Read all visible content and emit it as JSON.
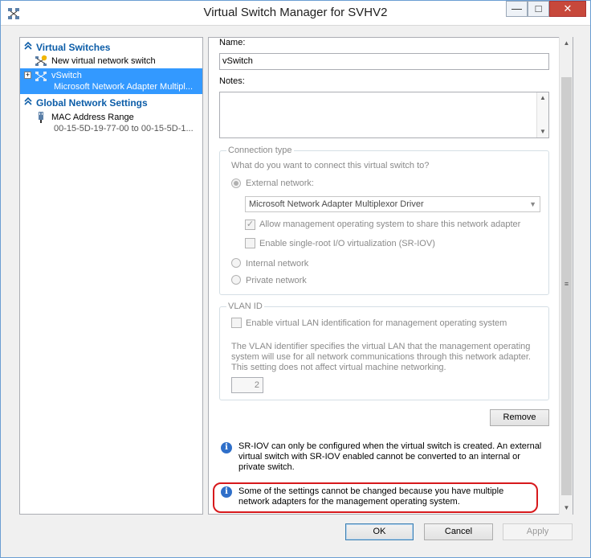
{
  "window": {
    "title": "Virtual Switch Manager for SVHV2"
  },
  "tree": {
    "sections": [
      {
        "label": "Virtual Switches"
      },
      {
        "label": "Global Network Settings"
      }
    ],
    "items": {
      "new_switch": "New virtual network switch",
      "vswitch_name": "vSwitch",
      "vswitch_adapter": "Microsoft Network Adapter Multipl...",
      "mac_range": "MAC Address Range",
      "mac_range_value": "00-15-5D-19-77-00 to 00-15-5D-1..."
    }
  },
  "form": {
    "name_label": "Name:",
    "name_value": "vSwitch",
    "notes_label": "Notes:",
    "connection": {
      "legend": "Connection type",
      "question": "What do you want to connect this virtual switch to?",
      "external_label": "External network:",
      "adapter_selected": "Microsoft Network Adapter Multiplexor Driver",
      "allow_mgmt_label": "Allow management operating system to share this network adapter",
      "sriov_label": "Enable single-root I/O virtualization (SR-IOV)",
      "internal_label": "Internal network",
      "private_label": "Private network"
    },
    "vlan": {
      "legend": "VLAN ID",
      "enable_label": "Enable virtual LAN identification for management operating system",
      "description": "The VLAN identifier specifies the virtual LAN that the management operating system will use for all network communications through this network adapter. This setting does not affect virtual machine networking.",
      "id_value": "2"
    },
    "remove_label": "Remove",
    "info1": "SR-IOV can only be configured when the virtual switch is created. An external virtual switch with SR-IOV enabled cannot be converted to an internal or private switch.",
    "info2": "Some of the settings cannot be changed because you have multiple network adapters for the management operating system."
  },
  "footer": {
    "ok": "OK",
    "cancel": "Cancel",
    "apply": "Apply"
  },
  "colors": {
    "accent": "#3399ff",
    "section": "#0c5da8",
    "highlight": "#d7191c",
    "info": "#2f6fc9"
  },
  "icons": {
    "app": "virtual-switch-icon",
    "section": "double-chevron-up-icon",
    "info": "info-icon"
  }
}
